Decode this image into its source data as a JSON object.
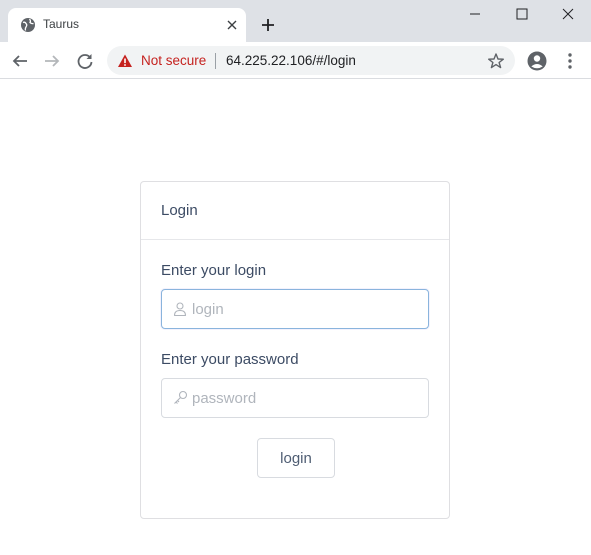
{
  "browser": {
    "tab_title": "Taurus",
    "security_label": "Not secure",
    "url": "64.225.22.106/#/login"
  },
  "login_card": {
    "title": "Login",
    "login_label": "Enter your login",
    "login_placeholder": "login",
    "password_label": "Enter your password",
    "password_placeholder": "password",
    "submit_label": "login"
  },
  "icons": {
    "tab_favicon": "globe-icon",
    "security": "warning-icon",
    "login_field": "user-icon",
    "password_field": "key-icon"
  },
  "colors": {
    "security_warning": "#c5221f",
    "focused_input_border": "#8ab4dd",
    "text": "#3c4b64"
  }
}
